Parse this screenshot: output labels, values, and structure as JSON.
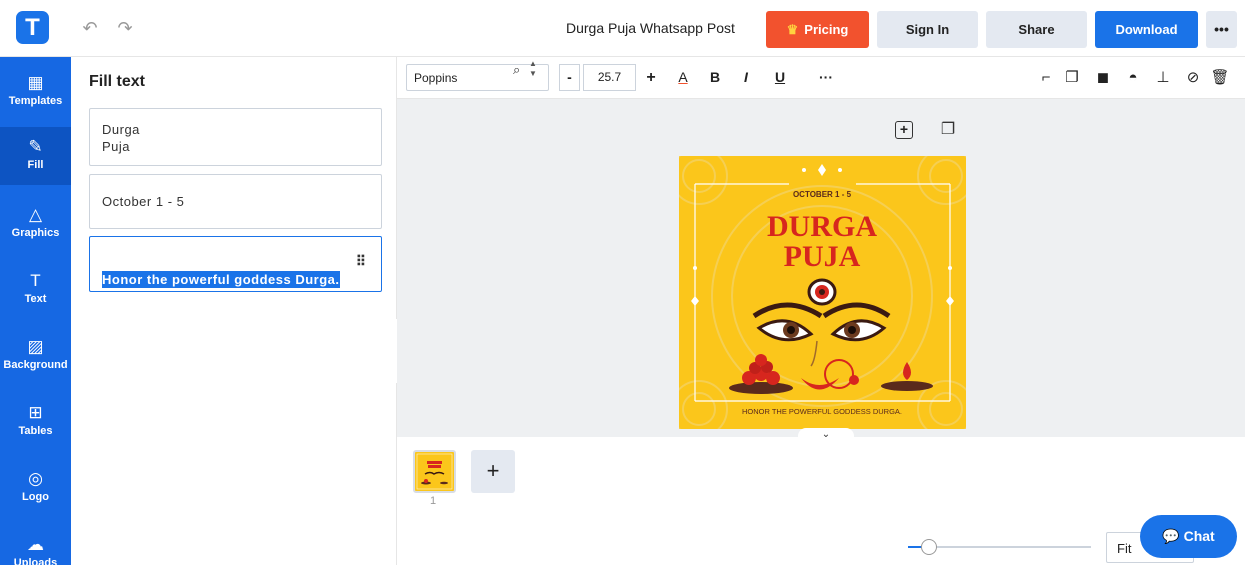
{
  "app": {
    "logo_letter": "T",
    "title": "Durga Puja Whatsapp Post",
    "accent": "#1a73e8",
    "pricing_color": "#f2522e"
  },
  "header": {
    "undo_icon": "undo-icon",
    "redo_icon": "redo-icon",
    "pricing_label": "Pricing",
    "signin_label": "Sign In",
    "share_label": "Share",
    "download_label": "Download",
    "more_label": "•••"
  },
  "sidebar": {
    "items": [
      {
        "label": "Templates",
        "icon": "▦"
      },
      {
        "label": "Fill",
        "icon": "✎"
      },
      {
        "label": "Graphics",
        "icon": "△"
      },
      {
        "label": "Text",
        "icon": "T"
      },
      {
        "label": "Background",
        "icon": "▨"
      },
      {
        "label": "Tables",
        "icon": "⊞"
      },
      {
        "label": "Logo",
        "icon": "◎"
      },
      {
        "label": "Uploads",
        "icon": "☁"
      }
    ]
  },
  "panel": {
    "title": "Fill text",
    "fields": [
      {
        "value": "Durga\nPuja"
      },
      {
        "value": "October 1 - 5"
      },
      {
        "value": "Honor the powerful goddess Durga."
      }
    ]
  },
  "toolbar": {
    "font_name": "Poppins",
    "font_size": "25.7",
    "minus_label": "-",
    "plus_label": "+",
    "more_label": "···"
  },
  "poster": {
    "date_text": "OCTOBER 1 - 5",
    "title_line1": "DURGA",
    "title_line2": "PUJA",
    "caption": "HONOR THE POWERFUL GODDESS DURGA."
  },
  "pages": {
    "page_number": "1",
    "add_label": "+"
  },
  "footer": {
    "zoom_label": "Fit",
    "chat_label": "Chat"
  }
}
